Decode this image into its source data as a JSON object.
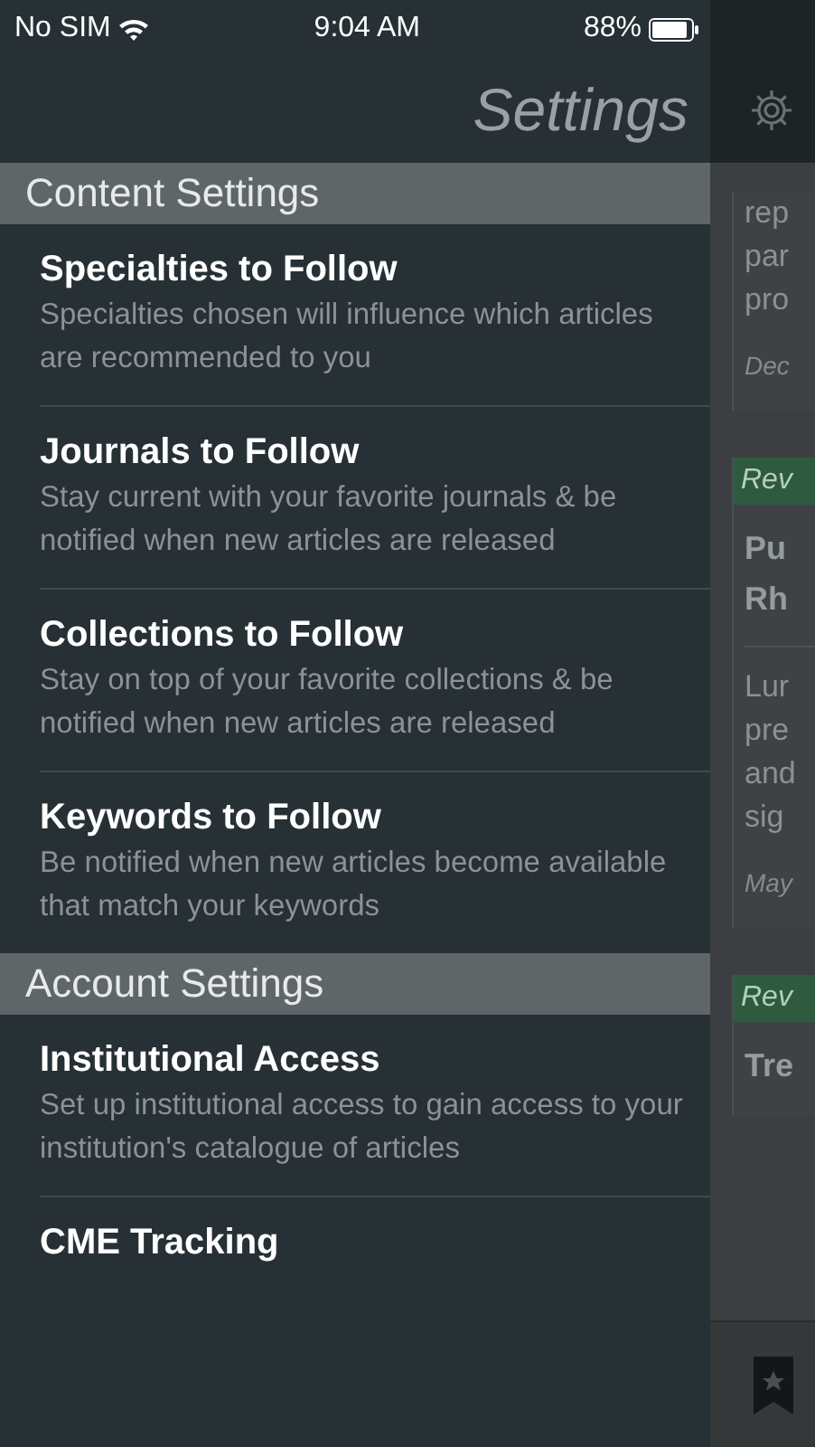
{
  "status_bar": {
    "carrier": "No SIM",
    "time": "9:04 AM",
    "battery": "88%"
  },
  "header": {
    "title": "Settings"
  },
  "sections": [
    {
      "title": "Content Settings",
      "items": [
        {
          "title": "Specialties to Follow",
          "description": "Specialties chosen will influence which articles are recommended to you"
        },
        {
          "title": "Journals to Follow",
          "description": "Stay current with your favorite journals & be notified when new articles are released"
        },
        {
          "title": "Collections to Follow",
          "description": "Stay on top of your favorite collections & be notified when new articles are released"
        },
        {
          "title": "Keywords to Follow",
          "description": "Be notified when new articles become available that match your keywords"
        }
      ]
    },
    {
      "title": "Account Settings",
      "items": [
        {
          "title": "Institutional Access",
          "description": "Set up institutional access to gain access to your institution's catalogue of articles"
        },
        {
          "title": "CME Tracking"
        }
      ]
    }
  ],
  "background_cards": [
    {
      "lines": [
        "rep",
        "par",
        "pro"
      ],
      "date": "Dec"
    },
    {
      "tag": "Rev",
      "title_lines": [
        "Pu",
        "Rh"
      ],
      "lines": [
        "Lur",
        "pre",
        "and",
        "sig"
      ],
      "date": "May"
    },
    {
      "tag": "Rev",
      "title_lines": [
        "Tre"
      ]
    }
  ]
}
